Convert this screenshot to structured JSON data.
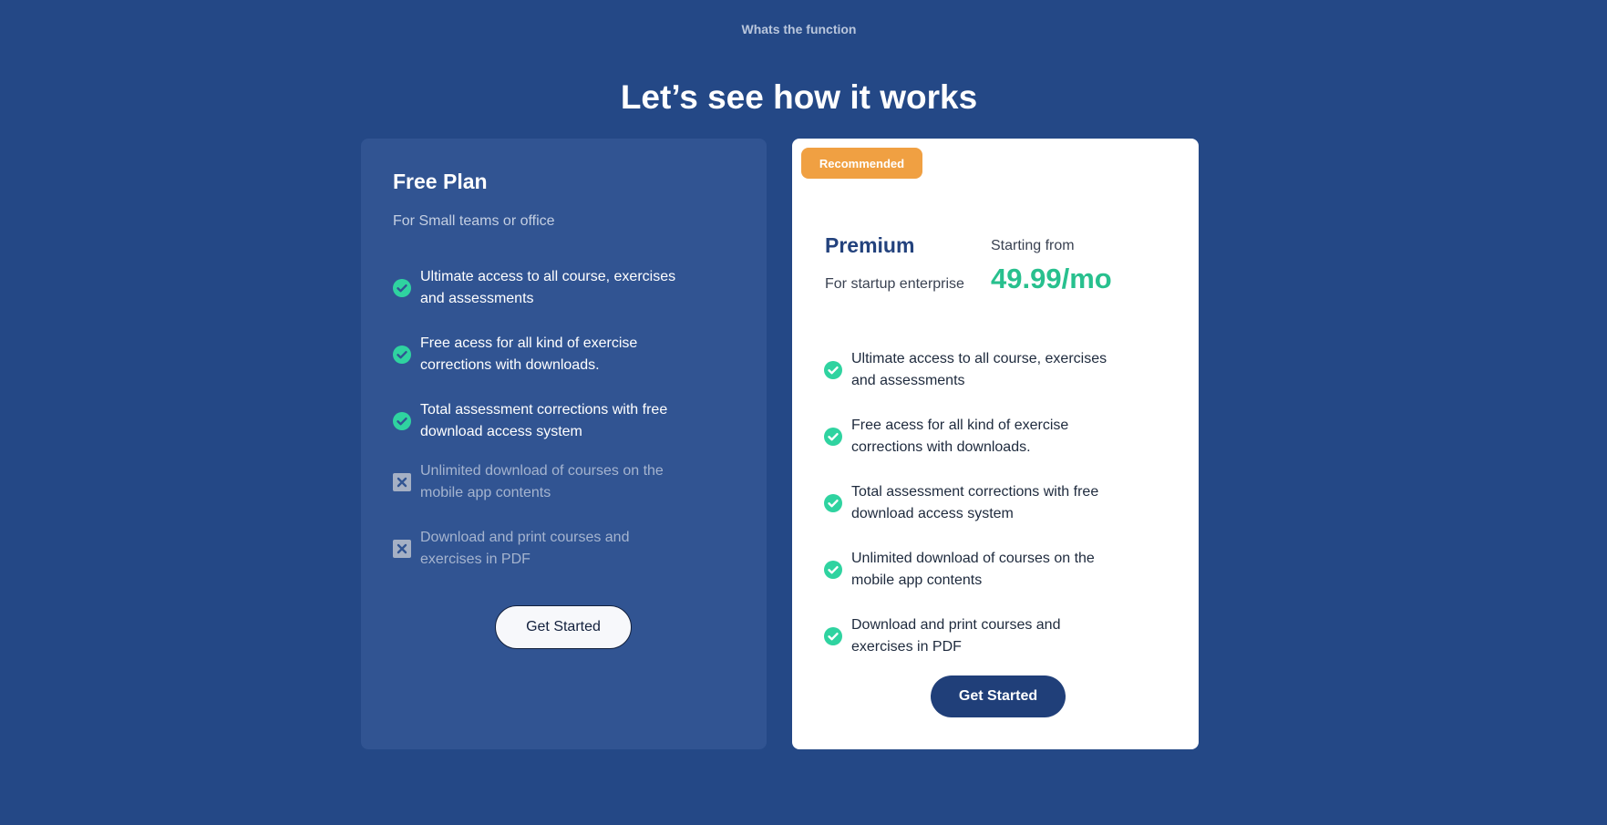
{
  "eyebrow": "Whats the function",
  "heading": "Let’s see how it works",
  "free_plan": {
    "title": "Free Plan",
    "subtitle": "For Small teams or office",
    "features": [
      {
        "text": "Ultimate access to all course, exercises and assessments",
        "included": true
      },
      {
        "text": "Free acess for all kind of exercise corrections with downloads.",
        "included": true
      },
      {
        "text": "Total assessment corrections with free download access system",
        "included": true
      },
      {
        "text": "Unlimited download of courses on the mobile app contents",
        "included": false
      },
      {
        "text": "Download and print courses and exercises in PDF",
        "included": false
      }
    ],
    "button_label": "Get Started"
  },
  "premium_plan": {
    "badge": "Recommended",
    "title": "Premium",
    "subtitle": "For startup enterprise",
    "starting_label": "Starting from",
    "price": "49.99/mo",
    "features": [
      {
        "text": "Ultimate access to all course, exercises and assessments",
        "included": true
      },
      {
        "text": "Free acess for all kind of exercise corrections with downloads.",
        "included": true
      },
      {
        "text": "Total assessment corrections with free download access system",
        "included": true
      },
      {
        "text": "Unlimited download of courses on the mobile app contents",
        "included": true
      },
      {
        "text": "Download and print courses and exercises in PDF",
        "included": true
      }
    ],
    "button_label": "Get Started"
  },
  "icons": {
    "included": "check-circle-icon",
    "excluded": "x-box-icon"
  },
  "colors": {
    "background": "#244886",
    "free_card": "#315492",
    "accent_green": "#28c08e",
    "badge_orange": "#f0a042",
    "premium_button": "#203f79"
  }
}
